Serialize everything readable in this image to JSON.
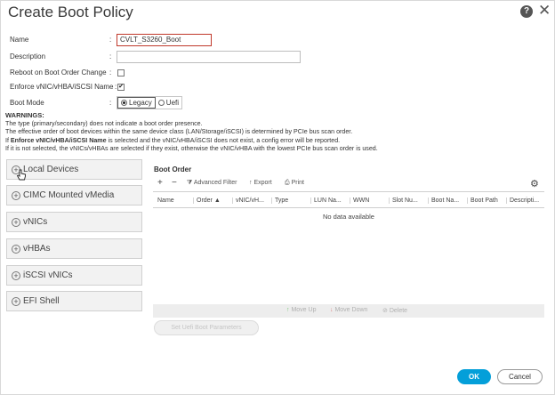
{
  "dialog": {
    "title": "Create Boot Policy",
    "help_icon": "?",
    "close_icon": "✕"
  },
  "form": {
    "name_label": "Name",
    "name_value": "CVLT_S3260_Boot",
    "description_label": "Description",
    "description_value": "",
    "reboot_label": "Reboot on Boot Order Change",
    "reboot_checked": false,
    "enforce_label": "Enforce vNIC/vHBA/iSCSI Name",
    "enforce_checked": true,
    "enforce_mark": "✔",
    "bootmode_label": "Boot Mode",
    "bootmode_options": [
      "Legacy",
      "Uefi"
    ],
    "bootmode_selected": "Legacy",
    "colon": ":"
  },
  "warnings": {
    "title": "WARNINGS:",
    "line1": "The type (primary/secondary) does not indicate a boot order presence.",
    "line2": "The effective order of boot devices within the same device class (LAN/Storage/iSCSI) is determined by PCIe bus scan order.",
    "line3_pre": "If ",
    "line3_bold": "Enforce vNIC/vHBA/iSCSI Name",
    "line3_post": " is selected and the vNIC/vHBA/iSCSI does not exist, a config error will be reported.",
    "line4": "If it is not selected, the vNICs/vHBAs are selected if they exist, otherwise the vNIC/vHBA with the lowest PCIe bus scan order is used."
  },
  "devices": {
    "items": [
      {
        "label": "Local Devices"
      },
      {
        "label": "CIMC Mounted vMedia"
      },
      {
        "label": "vNICs"
      },
      {
        "label": "vHBAs"
      },
      {
        "label": "iSCSI vNICs"
      },
      {
        "label": "EFI Shell"
      }
    ],
    "plus_glyph": "+"
  },
  "boot_order": {
    "title": "Boot Order",
    "toolbar": {
      "add": "+",
      "remove": "−",
      "advanced_filter": "Advanced Filter",
      "export": "Export",
      "print": "Print",
      "filter_glyph": "⧩",
      "export_glyph": "↑",
      "print_glyph": "⎙",
      "gear_glyph": "⚙"
    },
    "columns": [
      "Name",
      "Order",
      "vNIC/vH...",
      "Type",
      "LUN Na...",
      "WWN",
      "Slot Nu...",
      "Boot Na...",
      "Boot Path",
      "Descripti..."
    ],
    "sort_glyph": "▲",
    "empty_text": "No data available",
    "actions": {
      "move_up": "Move Up",
      "move_down": "Move Down",
      "delete": "Delete",
      "up_glyph": "↑",
      "down_glyph": "↓",
      "delete_glyph": "⊘"
    },
    "set_uefi": "Set Uefi Boot Parameters"
  },
  "footer": {
    "ok": "OK",
    "cancel": "Cancel"
  },
  "colors": {
    "primary_button": "#049fd9",
    "focus_border": "#c0392b"
  }
}
